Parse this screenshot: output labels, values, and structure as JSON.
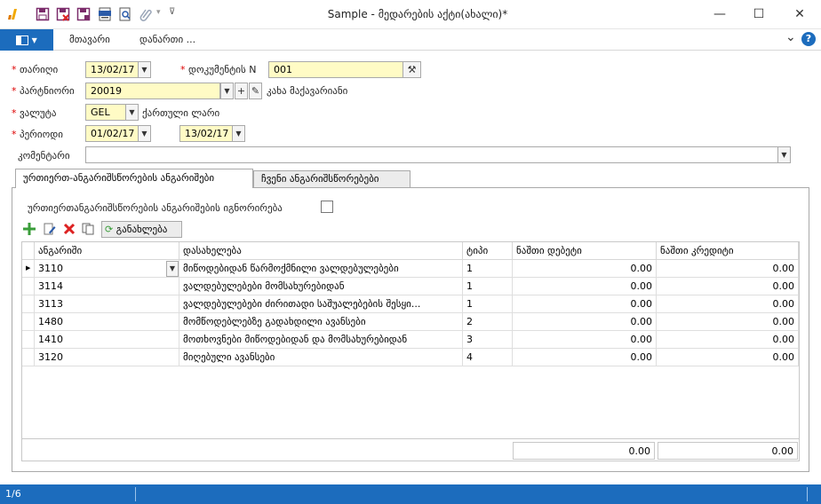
{
  "window": {
    "title": "Sample - მედარების აქტი(ახალი)*",
    "minimize": "—",
    "maximize": "☐",
    "close": "✕"
  },
  "ribbon": {
    "file_icon": "panel-icon",
    "tabs": [
      "მთავარი",
      "დანართი ..."
    ],
    "collapse": "⌄",
    "help": "?"
  },
  "form": {
    "date_label": "თარიღი",
    "date_value": "13/02/17",
    "docnum_label": "დოკუმენტის N",
    "docnum_value": "001",
    "partner_label": "პარტნიორი",
    "partner_value": "20019",
    "partner_name": "კახა მაქავარიანი",
    "currency_label": "ვალუტა",
    "currency_value": "GEL",
    "currency_name": "ქართული ლარი",
    "period_label": "პერიოდი",
    "period_from": "01/02/17",
    "period_to": "13/02/17",
    "comment_label": "კომენტარი",
    "comment_value": ""
  },
  "tabs": {
    "tab1": "ურთიერთ-ანგარიშსწორების ანგარიშები",
    "tab2": "ჩვენი ანგარიშსწორებები"
  },
  "panel": {
    "ignore_label": "ურთიერთანგარიშსწორების ანგარიშების იგნორირება",
    "refresh_label": "განახლება"
  },
  "grid": {
    "columns": [
      "ანგარიში",
      "დასახელება",
      "ტიპი",
      "ნაშთი დებეტი",
      "ნაშთი კრედიტი"
    ],
    "rows": [
      {
        "account": "3110",
        "name": "მიწოდებიდან წარმოქმნილი ვალდებულებები",
        "type": "1",
        "debit": "0.00",
        "credit": "0.00"
      },
      {
        "account": "3114",
        "name": "ვალდებულებები მომსახურებიდან",
        "type": "1",
        "debit": "0.00",
        "credit": "0.00"
      },
      {
        "account": "3113",
        "name": "ვალდებულებები ძირითადი საშუალებების შესყი...",
        "type": "1",
        "debit": "0.00",
        "credit": "0.00"
      },
      {
        "account": "1480",
        "name": "მომწოდებლებზე გადახდილი ავანსები",
        "type": "2",
        "debit": "0.00",
        "credit": "0.00"
      },
      {
        "account": "1410",
        "name": "მოთხოვნები მიწოდებიდან და მომსახურებიდან",
        "type": "3",
        "debit": "0.00",
        "credit": "0.00"
      },
      {
        "account": "3120",
        "name": "მიღებული ავანსები",
        "type": "4",
        "debit": "0.00",
        "credit": "0.00"
      }
    ],
    "total_debit": "0.00",
    "total_credit": "0.00"
  },
  "status": {
    "record_pos": "1/6"
  },
  "colors": {
    "accent": "#1c6cbd",
    "required": "#dd0000",
    "input_highlight": "#fffbc5"
  }
}
